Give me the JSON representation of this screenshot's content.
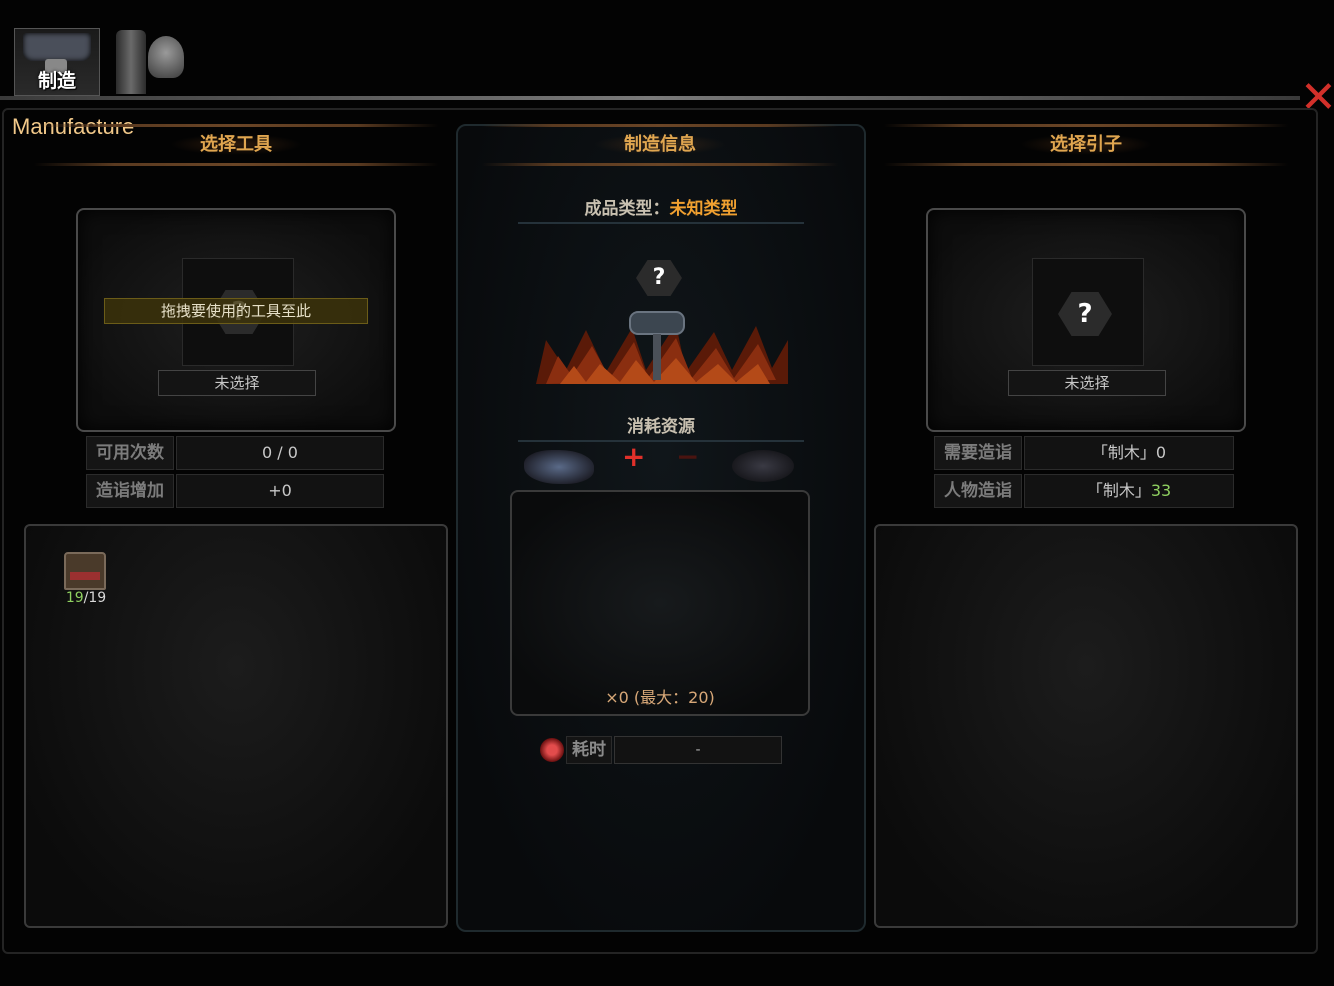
{
  "tabs": [
    {
      "label": "制造"
    }
  ],
  "window_title": "Manufacture",
  "left": {
    "header": "选择工具",
    "slot_placeholder": "?",
    "drag_tip": "拖拽要使用的工具至此",
    "not_selected": "未选择",
    "stats": [
      {
        "label": "可用次数",
        "value": "0 / 0"
      },
      {
        "label": "造诣增加",
        "value": "+0"
      }
    ],
    "items": [
      {
        "icon": "chest-icon",
        "count_current": "19",
        "count_sep": "/19"
      }
    ]
  },
  "middle": {
    "header": "制造信息",
    "product_type_label": "成品类型：",
    "product_type_value": "未知类型",
    "product_placeholder": "?",
    "consume_title": "消耗资源",
    "plus_sign": "+",
    "minus_sign": "−",
    "quantity_text": "×0 (最大：20)",
    "time_label": "耗时",
    "time_value": "-"
  },
  "right": {
    "header": "选择引子",
    "slot_placeholder": "?",
    "not_selected": "未选择",
    "stats": [
      {
        "label": "需要造诣",
        "value": "「制木」0"
      },
      {
        "label": "人物造诣",
        "value_prefix": "「制木」",
        "value_num": "33"
      }
    ]
  },
  "colors": {
    "accent_orange": "#e0a650",
    "unknown_type": "#f0a030",
    "close": "#d2302a",
    "green_value": "#8fd060"
  }
}
